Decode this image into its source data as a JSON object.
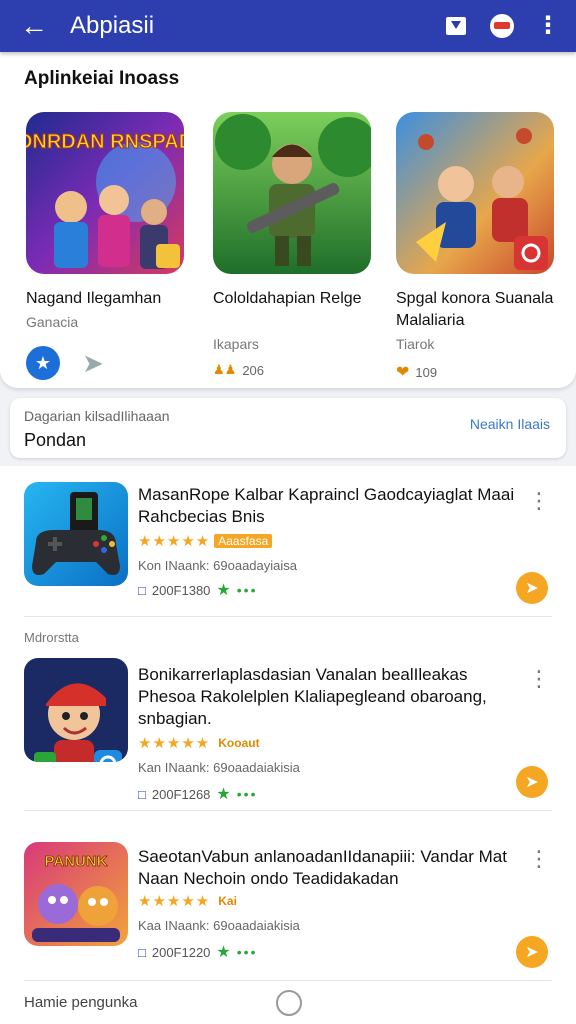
{
  "appbar": {
    "title": "Abpiasii",
    "icons": [
      "back-arrow-icon",
      "filter-icon",
      "record-icon",
      "more-vert-icon"
    ]
  },
  "featured": {
    "heading": "Aplinkeiai Inoass",
    "cards": [
      {
        "art_text": "KONRDAN RNSPADA",
        "name": "Nagand Ilegamhan",
        "sub": "Ganacia",
        "meta": ""
      },
      {
        "name": "Cololdahapian Relge",
        "sub": "Ikapars",
        "meta": "206"
      },
      {
        "name": "Spgal konora Suanala Malaliaria",
        "sub": "Tiarok",
        "meta": "109"
      }
    ]
  },
  "section": {
    "small": "Dagarian kilsadIlihaaan",
    "big": "Pondan",
    "link": "Neaikn Ilaais"
  },
  "list": {
    "items": [
      {
        "title": "MasanRope Kalbar Kapraincl Gaodcayiaglat Maai Rahcbecias Bnis",
        "tag": "Aaasfasa",
        "line2": "Kon INaank: 69oaadayiaisa",
        "line3": "200F1380"
      },
      {
        "title": "Bonikarrerlaplasdasian Vanalan bealIleakas Phesoa Rakolelplen Klaliapegleand obaroang, snbagian.",
        "tag": "Kooaut",
        "line2": "Kan INaank: 69oaadaiakisia",
        "line3": "200F1268"
      },
      {
        "title": "SaeotanVabun anlanoadanIIdanapiii: Vandar Mat Naan Nechoin ondo Teadidakadan",
        "art_text": "PANUNK",
        "tag": "Kai",
        "line2": "Kaa INaank: 69oaadaiakisia",
        "line3": "200F1220"
      }
    ],
    "section_label": "Mdrorstta",
    "bottom_label": "Hamie pengunka"
  },
  "colors": {
    "appbar": "#2d3fae",
    "accent": "#f5a623",
    "green": "#2aa53a",
    "link": "#3a78c8"
  }
}
